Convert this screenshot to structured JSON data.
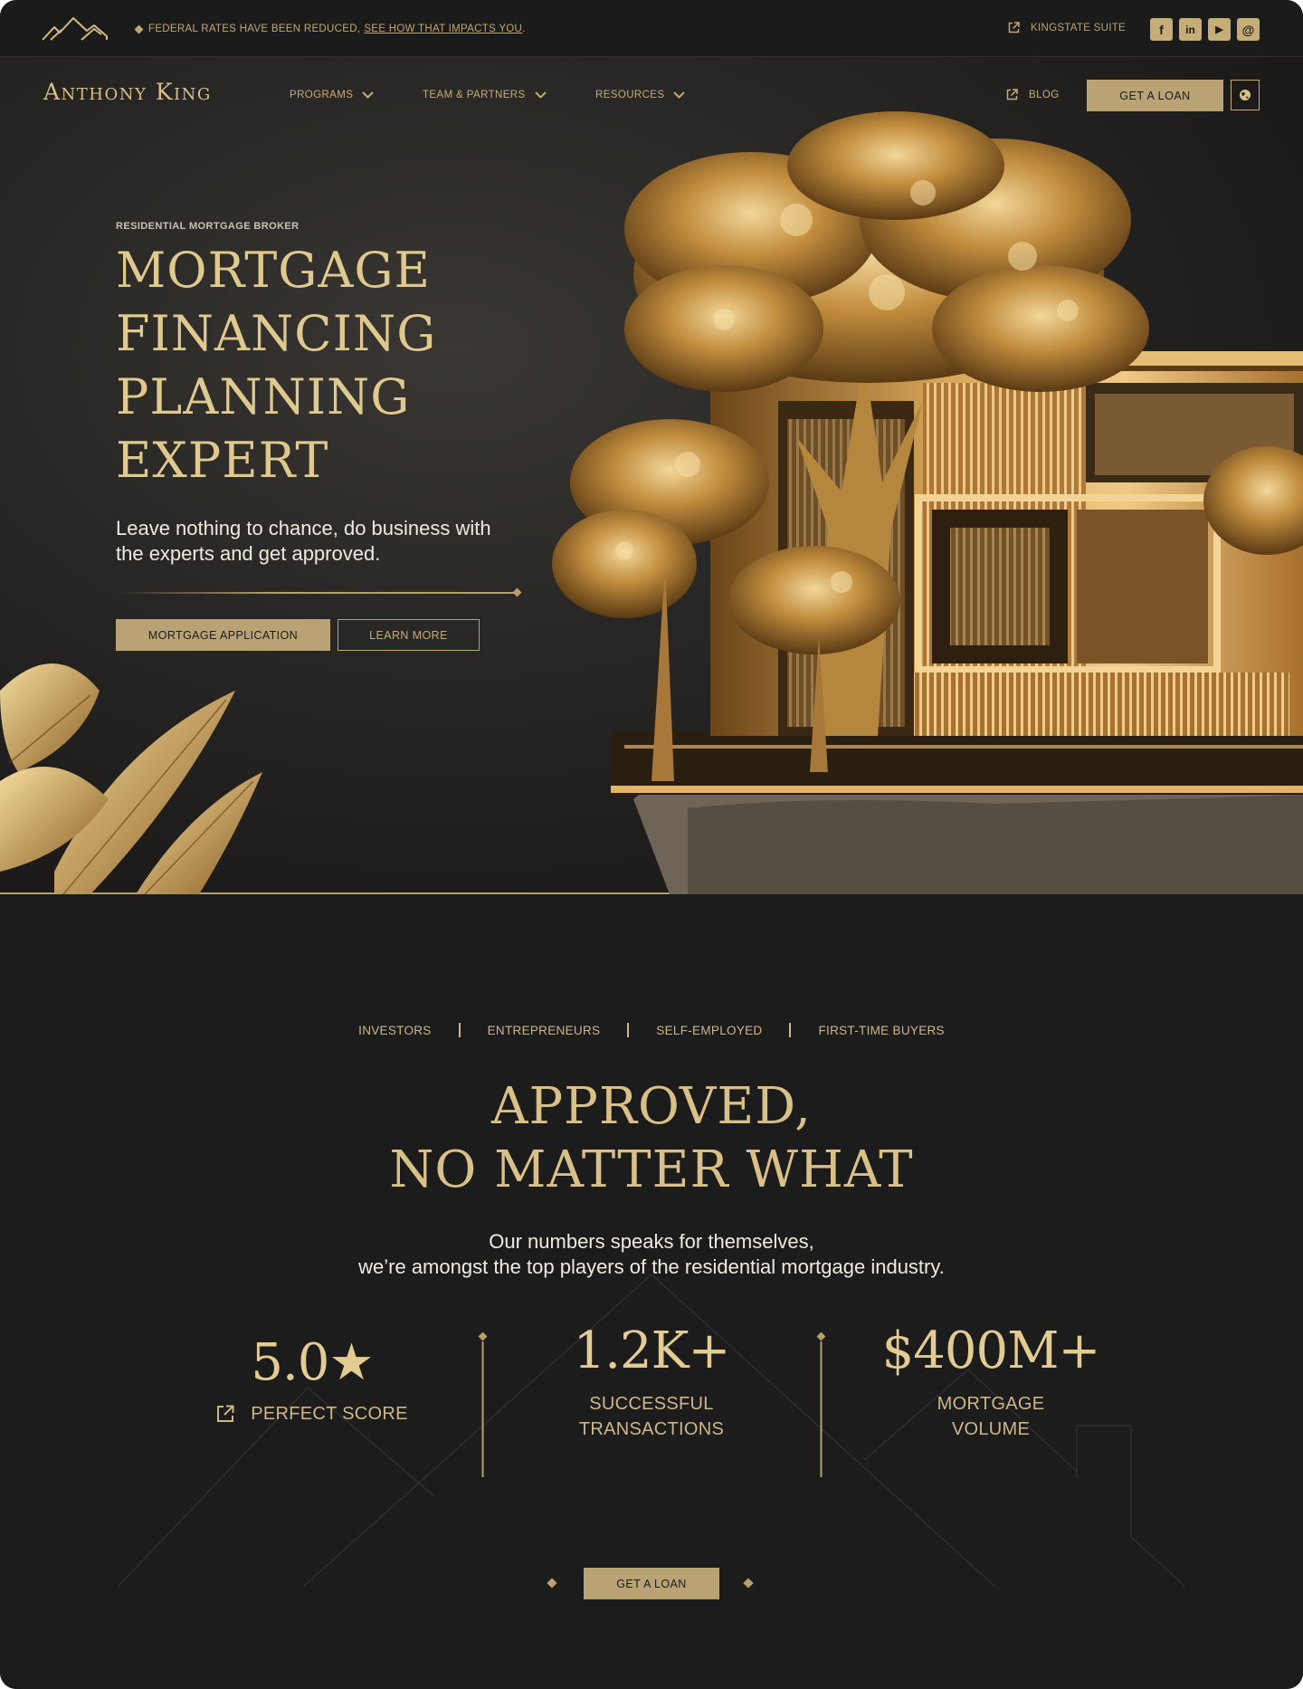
{
  "topbar": {
    "announcement_text": "Federal rates have been reduced,",
    "announcement_link": "See how that impacts you",
    "announcement_end": ".",
    "suite_label": "KINGSTATE SUITE",
    "socials": [
      {
        "icon": "facebook-icon",
        "glyph": "f"
      },
      {
        "icon": "linkedin-icon",
        "glyph": "in"
      },
      {
        "icon": "youtube-icon",
        "glyph": "▶"
      },
      {
        "icon": "email-icon",
        "glyph": "@"
      }
    ]
  },
  "nav": {
    "brand": "Anthony King",
    "items": [
      {
        "label": "PROGRAMS"
      },
      {
        "label": "TEAM & PARTNERS"
      },
      {
        "label": "RESOURCES"
      }
    ],
    "blog_label": "BLOG",
    "cta_label": "GET A LOAN",
    "globe_icon": "globe-icon"
  },
  "hero": {
    "eyebrow": "RESIDENTIAL MORTGAGE BROKER",
    "title_lines": [
      "MORTGAGE",
      "FINANCING",
      "PLANNING",
      "EXPERT"
    ],
    "subtitle": "Leave nothing to chance, do business with the experts and get approved.",
    "primary_cta": "MORTGAGE APPLICATION",
    "secondary_cta": "LEARN MORE"
  },
  "segments": [
    "INVESTORS",
    "ENTREPRENEURS",
    "SELF-EMPLOYED",
    "FIRST-TIME BUYERS"
  ],
  "approved": {
    "title_lines": [
      "APPROVED,",
      "NO MATTER WHAT"
    ],
    "subtitle_lines": [
      "Our numbers speaks for themselves,",
      "we’re amongst the top players of the residential mortgage industry."
    ]
  },
  "stats": [
    {
      "value": "5.0★",
      "label": "PERFECT SCORE"
    },
    {
      "value": "1.2K+",
      "label_lines": [
        "SUCCESSFUL",
        "TRANSACTIONS"
      ]
    },
    {
      "value": "$400M+",
      "label_lines": [
        "MORTGAGE",
        "VOLUME"
      ]
    }
  ],
  "bottom_cta": "GET A LOAN",
  "colors": {
    "background": "#1c1c1c",
    "gold": "#b9a375",
    "gold_text": "#d9c088",
    "light_text": "#f0ebe0"
  }
}
